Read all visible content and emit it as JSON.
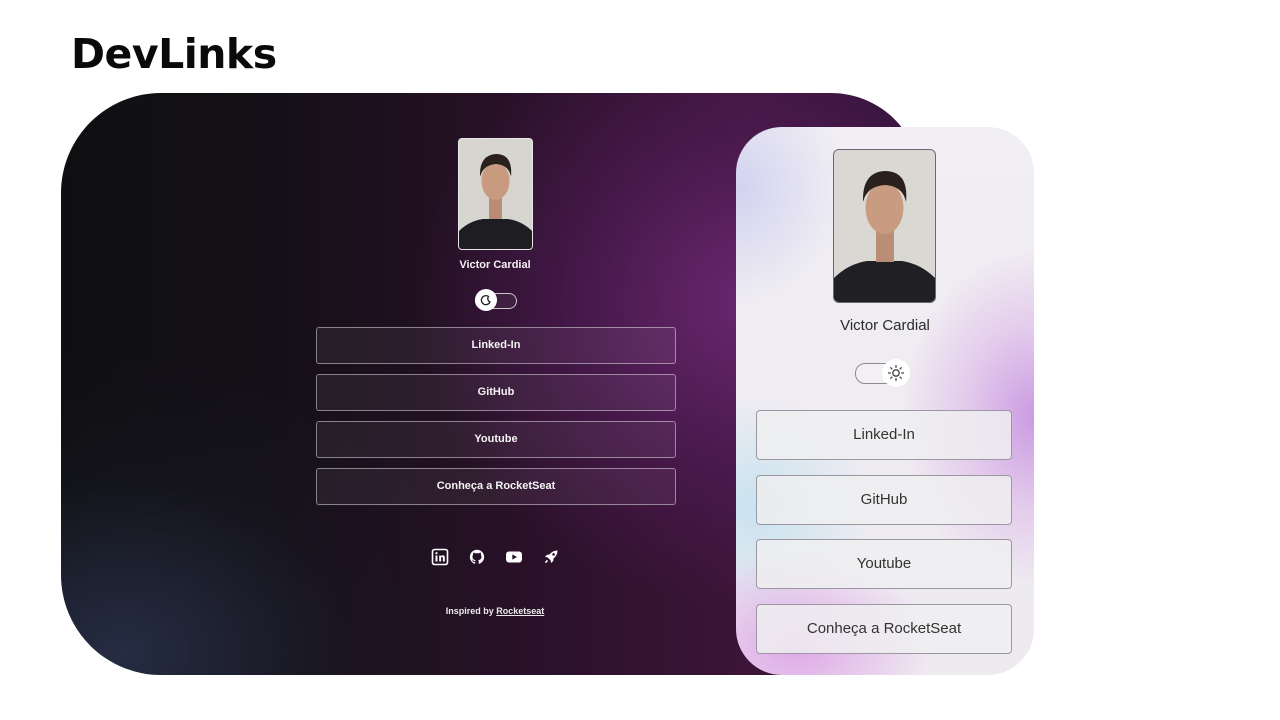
{
  "page": {
    "title": "DevLinks"
  },
  "dark_preview": {
    "profile_name": "Victor Cardial",
    "toggle_icon": "moon-icon",
    "links": [
      {
        "label": "Linked-In"
      },
      {
        "label": "GitHub"
      },
      {
        "label": "Youtube"
      },
      {
        "label": "Conheça a RocketSeat"
      }
    ],
    "social_icons": [
      "linkedin-icon",
      "github-icon",
      "youtube-icon",
      "rocket-icon"
    ],
    "footer_prefix": "Inspired by ",
    "footer_link": "Rocketseat"
  },
  "light_preview": {
    "profile_name": "Victor Cardial",
    "toggle_icon": "sun-icon",
    "links": [
      {
        "label": "Linked-In"
      },
      {
        "label": "GitHub"
      },
      {
        "label": "Youtube"
      },
      {
        "label": "Conheça a RocketSeat"
      }
    ]
  },
  "colors": {
    "dark_bg": "#141017",
    "dark_accent": "#702a78",
    "light_bg": "#f1eff3",
    "light_accent": "#c896e1"
  }
}
